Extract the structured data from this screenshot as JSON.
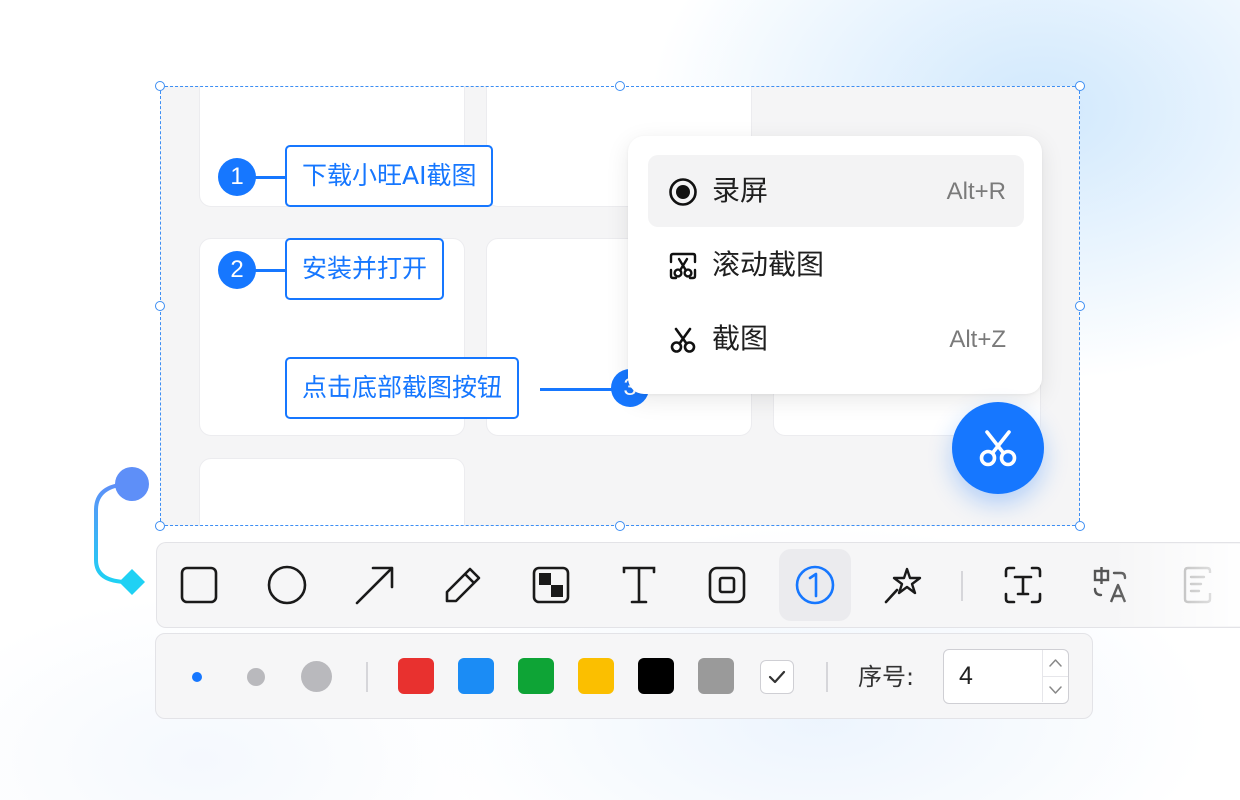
{
  "steps": [
    {
      "number": "1",
      "text": "下载小旺AI截图"
    },
    {
      "number": "2",
      "text": "安装并打开"
    },
    {
      "number": "3",
      "text": "点击底部截图按钮"
    }
  ],
  "menu": {
    "items": [
      {
        "icon": "record-icon",
        "label": "录屏",
        "shortcut": "Alt+R",
        "active": true
      },
      {
        "icon": "scroll-screenshot-icon",
        "label": "滚动截图",
        "shortcut": "",
        "active": false
      },
      {
        "icon": "scissors-icon",
        "label": "截图",
        "shortcut": "Alt+Z",
        "active": false
      }
    ]
  },
  "fab": {
    "icon": "scissors-icon"
  },
  "toolbar": {
    "tools": [
      {
        "name": "rectangle-tool",
        "icon": "square-icon",
        "active": false
      },
      {
        "name": "ellipse-tool",
        "icon": "circle-icon",
        "active": false
      },
      {
        "name": "arrow-tool",
        "icon": "arrow-icon",
        "active": false
      },
      {
        "name": "pen-tool",
        "icon": "pencil-icon",
        "active": false
      },
      {
        "name": "mosaic-tool",
        "icon": "mosaic-icon",
        "active": false
      },
      {
        "name": "text-tool",
        "icon": "text-icon",
        "active": false
      },
      {
        "name": "highlight-tool",
        "icon": "highlight-box-icon",
        "active": false
      },
      {
        "name": "number-tool",
        "icon": "numbered-circle-icon",
        "active": true
      },
      {
        "name": "magic-tool",
        "icon": "magic-wand-icon",
        "active": false
      },
      {
        "name": "ocr-tool",
        "icon": "text-recognition-icon",
        "active": false
      },
      {
        "name": "translate-tool",
        "icon": "translate-icon",
        "active": false
      },
      {
        "name": "summary-tool",
        "icon": "document-icon",
        "active": false
      }
    ]
  },
  "options": {
    "sizes": [
      "small",
      "medium",
      "large"
    ],
    "colors": [
      "#e8312f",
      "#1b8cf5",
      "#0ea436",
      "#fbbf00",
      "#000000",
      "#9a9a9a"
    ],
    "number_label": "序号:",
    "number_value": "4"
  },
  "colors": {
    "accent": "#1677ff",
    "selection": "#3d8ef3"
  }
}
